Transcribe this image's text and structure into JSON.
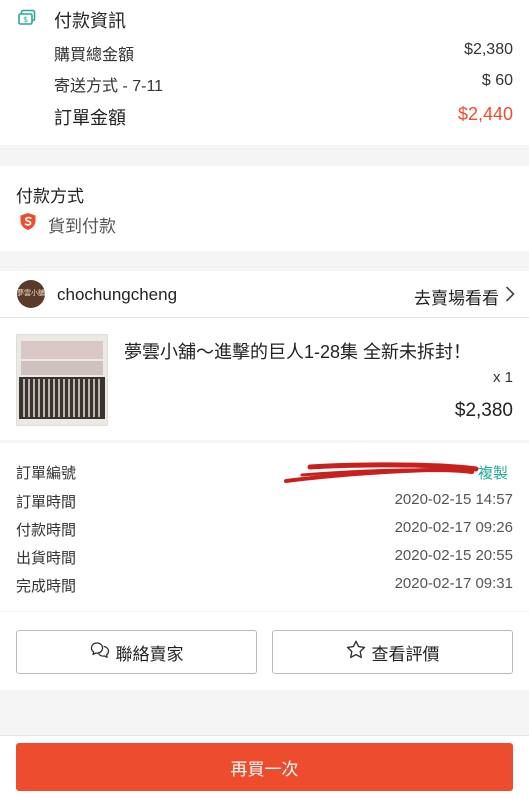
{
  "payment_info": {
    "title": "付款資訊",
    "rows": [
      {
        "label": "購買總金額",
        "value": "$2,380"
      },
      {
        "label": "寄送方式 - 7-11",
        "value": "$ 60"
      }
    ],
    "total_label": "訂單金額",
    "total_value": "$2,440"
  },
  "payment_method": {
    "title": "付款方式",
    "value": "貨到付款"
  },
  "shop": {
    "avatar_text": "夢雲小舖",
    "name": "chochungcheng",
    "link_label": "去賣場看看"
  },
  "product": {
    "name": "夢雲小舖～進擊的巨人1-28集 全新未拆封！",
    "quantity": "x 1",
    "price": "$2,380"
  },
  "order_details": {
    "rows": [
      {
        "label": "訂單編號",
        "value": ""
      },
      {
        "label": "訂單時間",
        "value": "2020-02-15 14:57"
      },
      {
        "label": "付款時間",
        "value": "2020-02-17 09:26"
      },
      {
        "label": "出貨時間",
        "value": "2020-02-15 20:55"
      },
      {
        "label": "完成時間",
        "value": "2020-02-17 09:31"
      }
    ],
    "copy_label": "複製"
  },
  "actions": {
    "contact_seller": "聯絡賣家",
    "view_rating": "查看評價",
    "buy_again": "再買一次"
  },
  "colors": {
    "accent": "#ee4d2d",
    "teal": "#26aa99",
    "redaction": "#c8201c"
  }
}
